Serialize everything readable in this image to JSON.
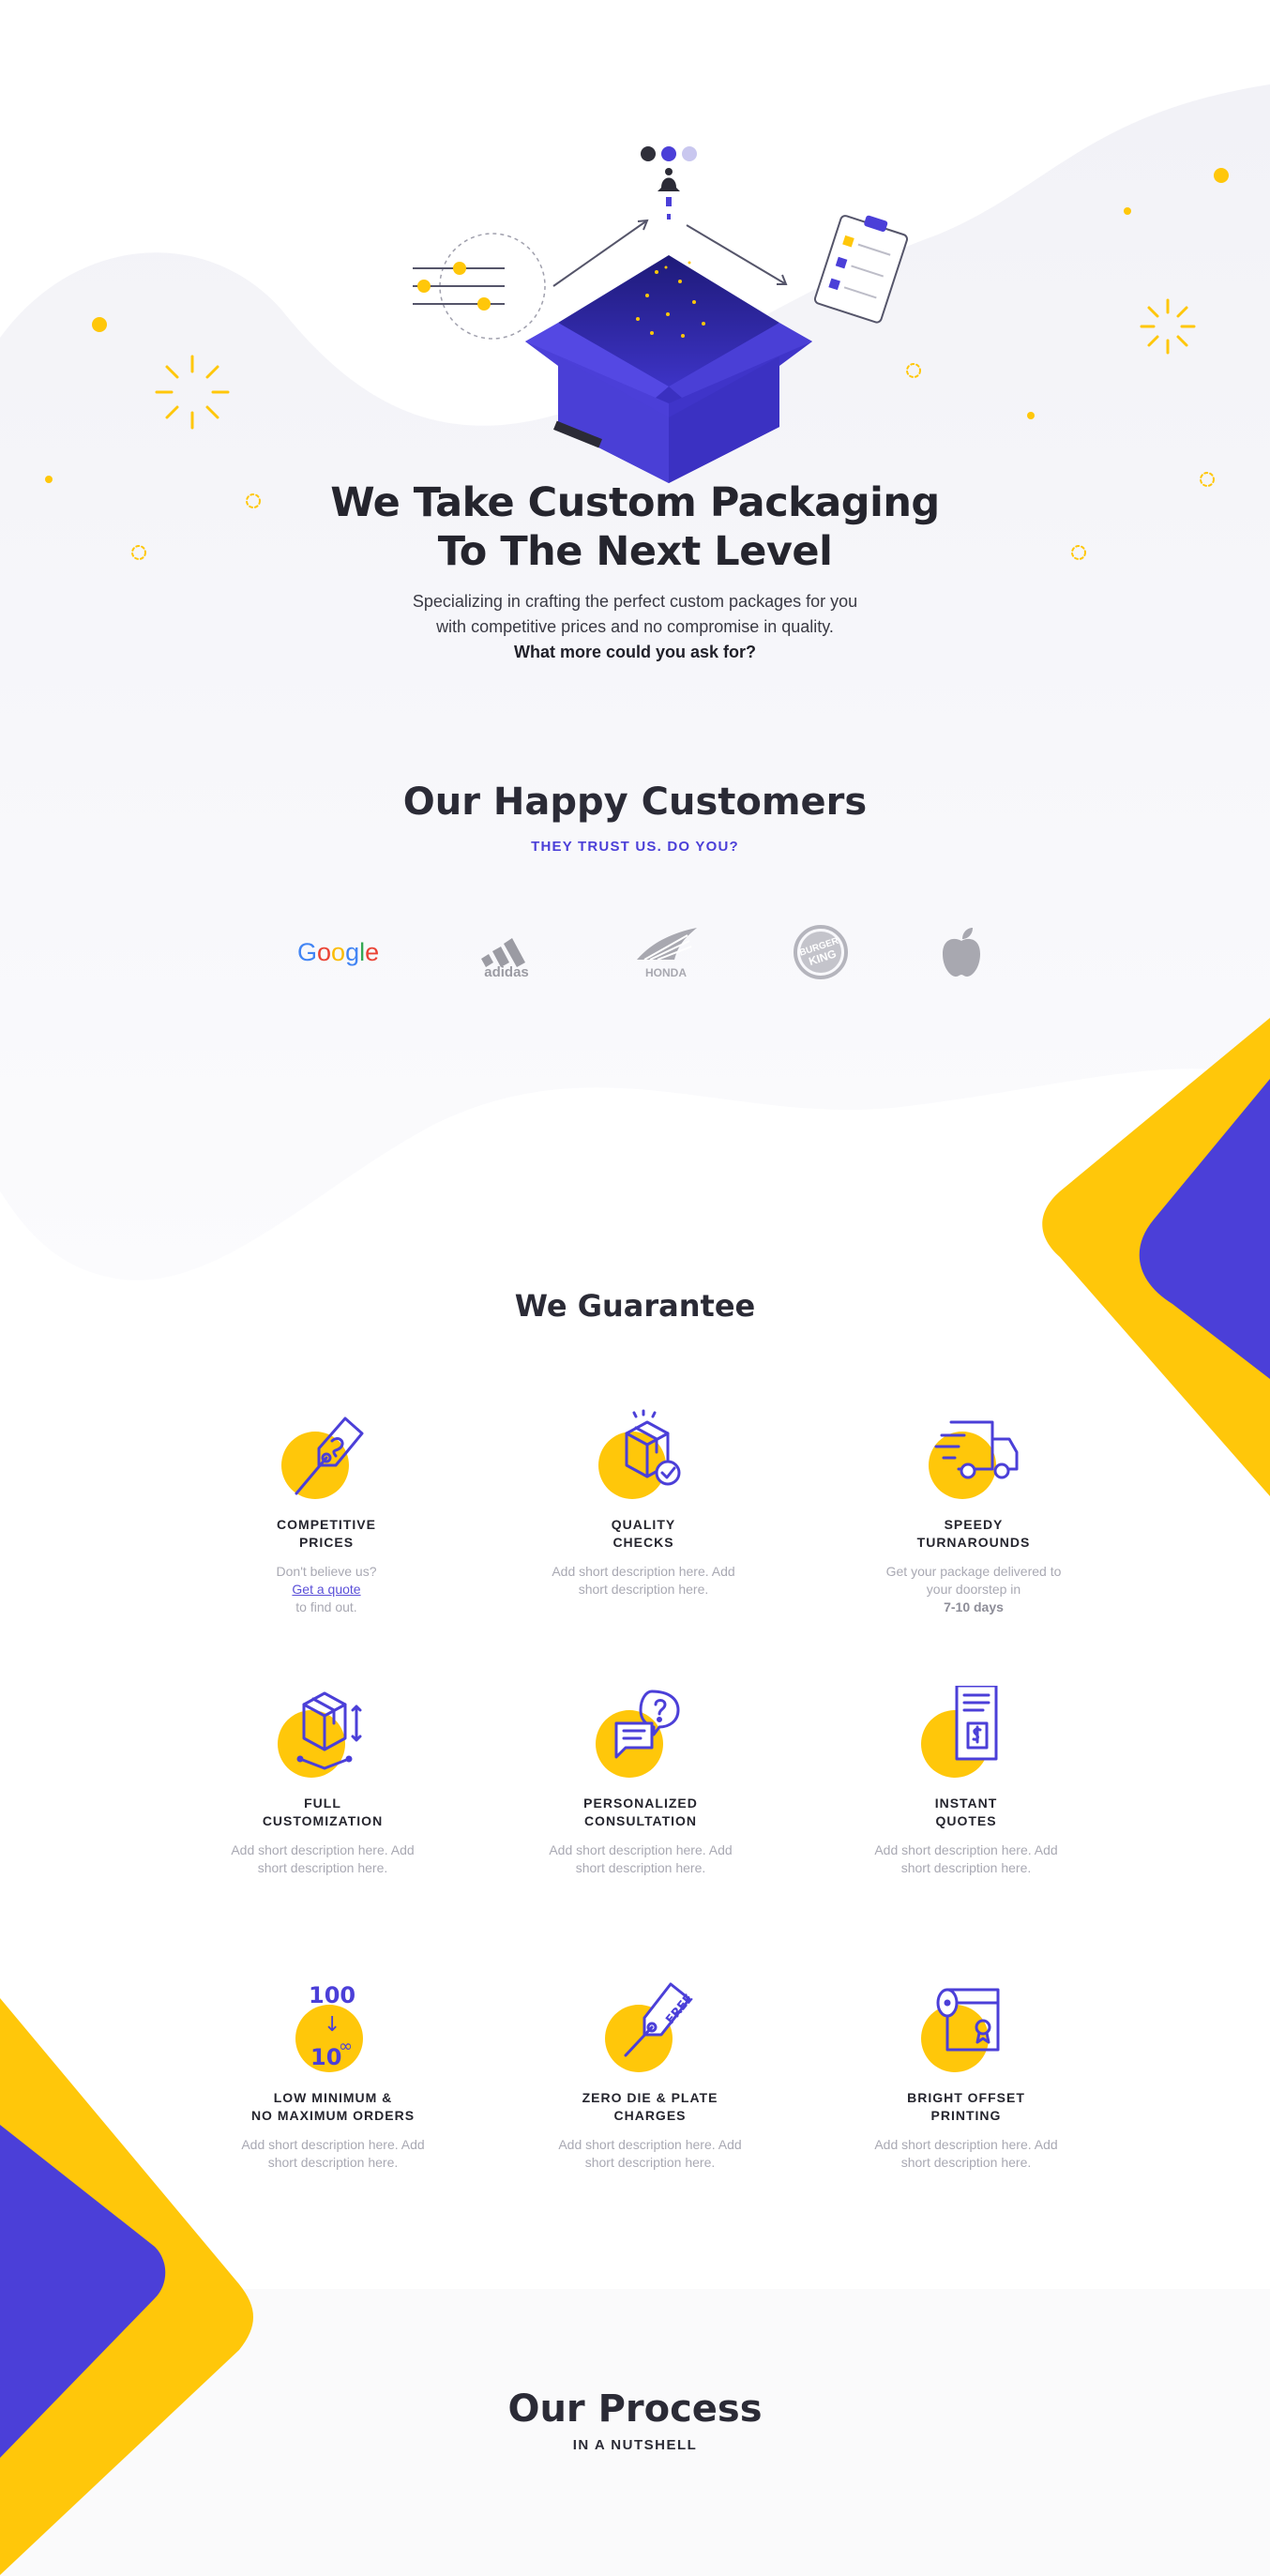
{
  "hero": {
    "title_line1": "We Take Custom Packaging",
    "title_line2": "To The Next Level",
    "sub_line1": "Specializing in crafting the perfect custom packages for you",
    "sub_line2": "with competitive prices and no compromise in quality.",
    "sub_line3": "What more could you ask for?"
  },
  "customers": {
    "title": "Our Happy Customers",
    "subtitle": "THEY TRUST US. DO YOU?",
    "logos": [
      {
        "icon": "google-logo",
        "text": "Google"
      },
      {
        "icon": "adidas-logo",
        "text": "adidas"
      },
      {
        "icon": "honda-logo",
        "text": "HONDA"
      },
      {
        "icon": "burger-king-logo",
        "text": "BURGER KING"
      },
      {
        "icon": "apple-logo",
        "text": ""
      }
    ]
  },
  "guarantee": {
    "title": "We Guarantee",
    "items": [
      {
        "icon": "price-tag-icon",
        "title1": "COMPETITIVE",
        "title2": "PRICES",
        "desc1": "Don't believe us?",
        "link": "Get a quote ",
        "desc2": "to find out."
      },
      {
        "icon": "quality-box-icon",
        "title1": "QUALITY",
        "title2": "CHECKS",
        "desc1": "Add short description here. Add",
        "desc2": "short description here."
      },
      {
        "icon": "delivery-truck-icon",
        "title1": "SPEEDY",
        "title2": "TURNAROUNDS",
        "desc1": "Get your package delivered to",
        "desc2": "your doorstep in ",
        "desc_bold": "7-10 days"
      },
      {
        "icon": "custom-box-icon",
        "title1": "FULL",
        "title2": "CUSTOMIZATION",
        "desc1": "Add short description here. Add",
        "desc2": "short description here."
      },
      {
        "icon": "consultation-chat-icon",
        "title1": "PERSONALIZED",
        "title2": "CONSULTATION",
        "desc1": "Add short description here. Add",
        "desc2": "short description here."
      },
      {
        "icon": "quote-document-icon",
        "title1": "INSTANT",
        "title2": "QUOTES",
        "desc1": "Add short description here. Add",
        "desc2": "short description here."
      },
      {
        "icon": "minimum-order-icon",
        "title1": "LOW MINIMUM &",
        "title2": "NO MAXIMUM ORDERS",
        "desc1": "Add short description here. Add",
        "desc2": "short description here.",
        "icon_text_top": "100",
        "icon_text_arrow": "↓",
        "icon_text_bottom": "10",
        "icon_text_inf": "∞"
      },
      {
        "icon": "free-tag-icon",
        "title1": "ZERO DIE & PLATE",
        "title2": "CHARGES",
        "desc1": "Add short description here. Add",
        "desc2": "short description here.",
        "icon_text": "FREE"
      },
      {
        "icon": "offset-print-icon",
        "title1": "BRIGHT OFFSET",
        "title2": "PRINTING",
        "desc1": "Add short description here. Add",
        "desc2": "short description here."
      }
    ]
  },
  "process": {
    "title": "Our Process",
    "subtitle": "IN A NUTSHELL"
  },
  "colors": {
    "accent_purple": "#4b3fd8",
    "accent_yellow": "#ffc70a",
    "wave_gray": "#f4f4f8"
  }
}
